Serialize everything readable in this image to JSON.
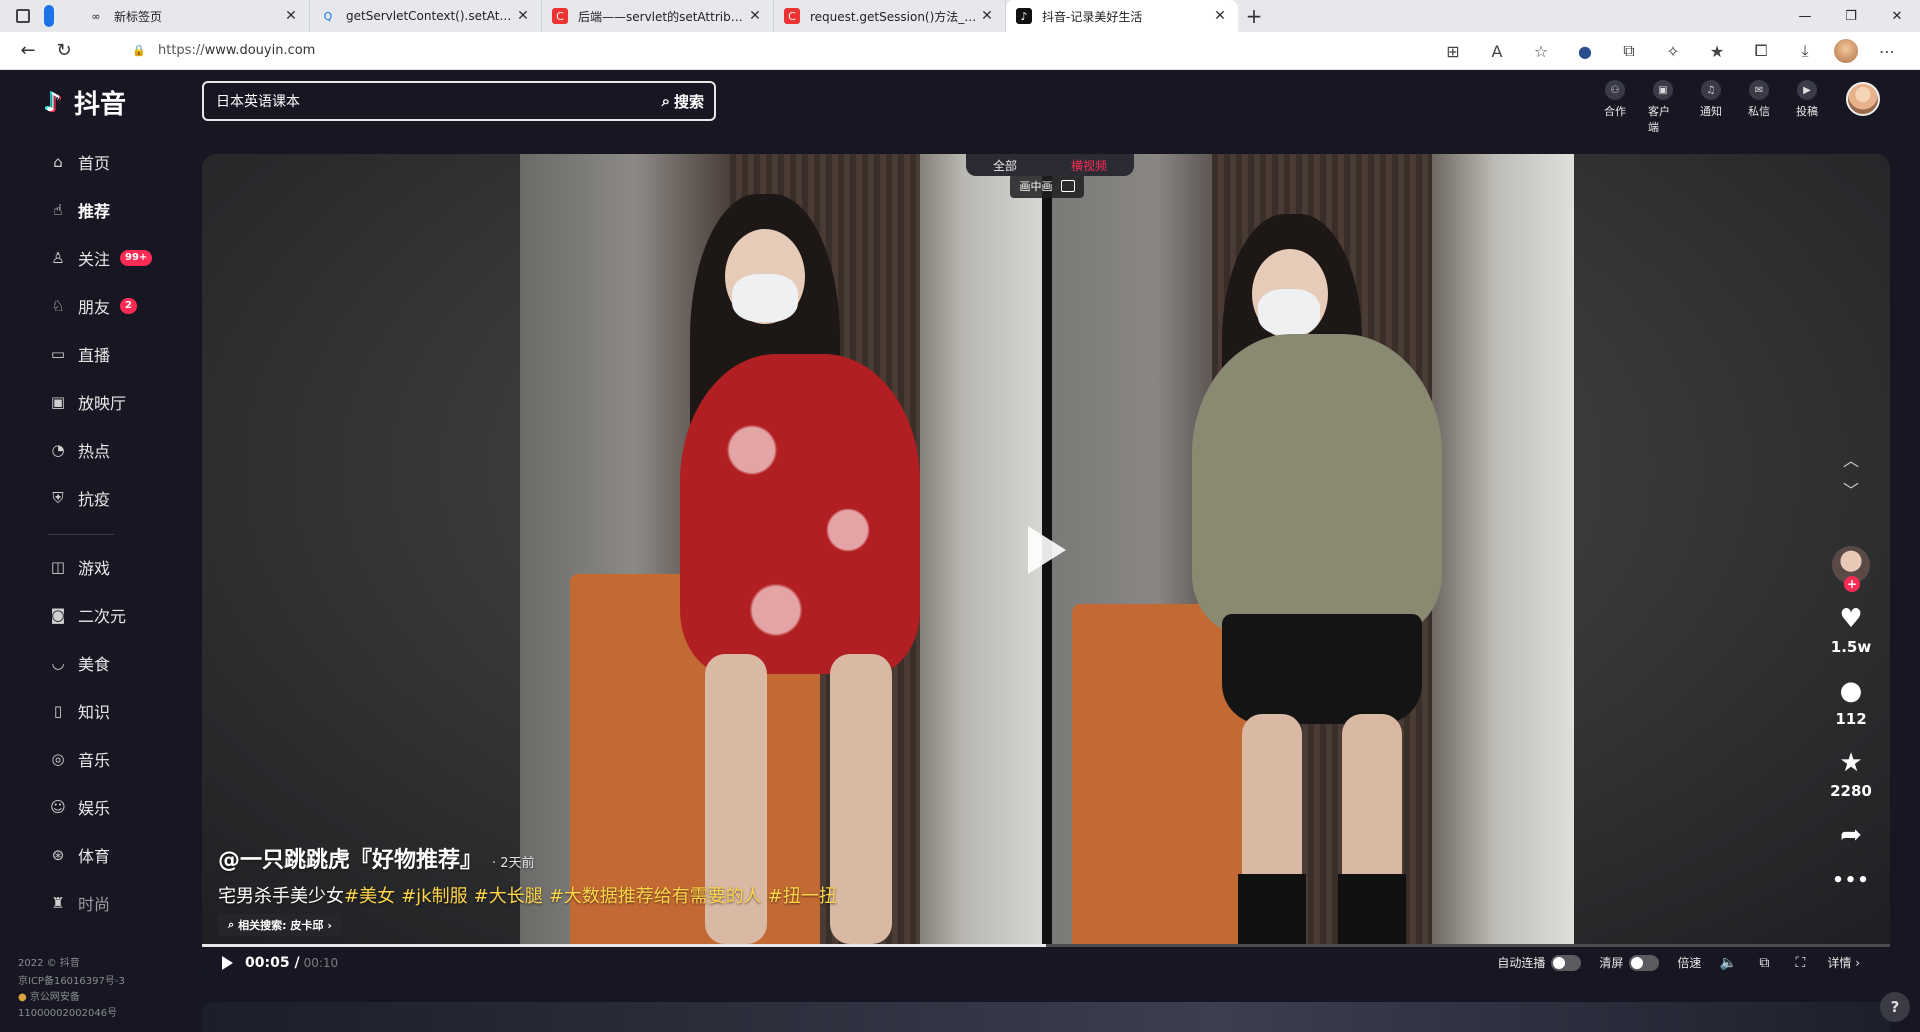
{
  "browser": {
    "tabs": [
      {
        "title": "新标签页",
        "icon": "∞"
      },
      {
        "title": "getServletContext().setAttribute",
        "icon": "Q"
      },
      {
        "title": "后端——servlet的setAttribute()",
        "icon": "C"
      },
      {
        "title": "request.getSession()方法_兴涛的",
        "icon": "C"
      },
      {
        "title": "抖音-记录美好生活",
        "icon": "♪"
      }
    ],
    "url_scheme": "https://",
    "url_host": "www.douyin.com"
  },
  "app": {
    "logo_text": "抖音",
    "search": {
      "value": "日本英语课本",
      "button": "搜索"
    },
    "top_actions": [
      {
        "label": "合作"
      },
      {
        "label": "客户端"
      },
      {
        "label": "通知"
      },
      {
        "label": "私信"
      },
      {
        "label": "投稿"
      }
    ],
    "sidebar": {
      "items": [
        {
          "label": "首页",
          "icon": "⌂"
        },
        {
          "label": "推荐",
          "icon": "👍"
        },
        {
          "label": "关注",
          "icon": "♙",
          "badge": "99+"
        },
        {
          "label": "朋友",
          "icon": "♘",
          "badge": "2"
        },
        {
          "label": "直播",
          "icon": "▭"
        },
        {
          "label": "放映厅",
          "icon": "▣"
        },
        {
          "label": "热点",
          "icon": "◔"
        },
        {
          "label": "抗疫",
          "icon": "⛨"
        },
        {
          "label": "游戏",
          "icon": "◫"
        },
        {
          "label": "二次元",
          "icon": "◙"
        },
        {
          "label": "美食",
          "icon": "◡"
        },
        {
          "label": "知识",
          "icon": "▯"
        },
        {
          "label": "音乐",
          "icon": "◎"
        },
        {
          "label": "娱乐",
          "icon": "☺"
        },
        {
          "label": "体育",
          "icon": "⊛"
        },
        {
          "label": "时尚",
          "icon": "♜"
        }
      ],
      "footer": [
        "2022 © 抖音",
        "京ICP备16016397号-3",
        "京公网安备",
        "11000002002046号"
      ]
    },
    "feed_tabs": [
      "全部",
      "横视频"
    ],
    "video": {
      "pip_label": "画中画",
      "author": "@一只跳跳虎『好物推荐』",
      "ago": "· 2天前",
      "desc_text": "宅男杀手美少女",
      "tags": [
        "#美女",
        "#jk制服",
        "#大长腿",
        "#大数据推荐给有需要的人",
        "#扭一扭"
      ],
      "related": "相关搜索: 皮卡邱",
      "likes": "1.5w",
      "comments": "112",
      "favorites": "2280",
      "current_time": "00:05 /",
      "duration": "00:10",
      "progress_fraction": 0.5
    },
    "controls": {
      "autoplay": "自动连播",
      "clear": "清屏",
      "speed": "倍速",
      "detail": "详情"
    }
  }
}
